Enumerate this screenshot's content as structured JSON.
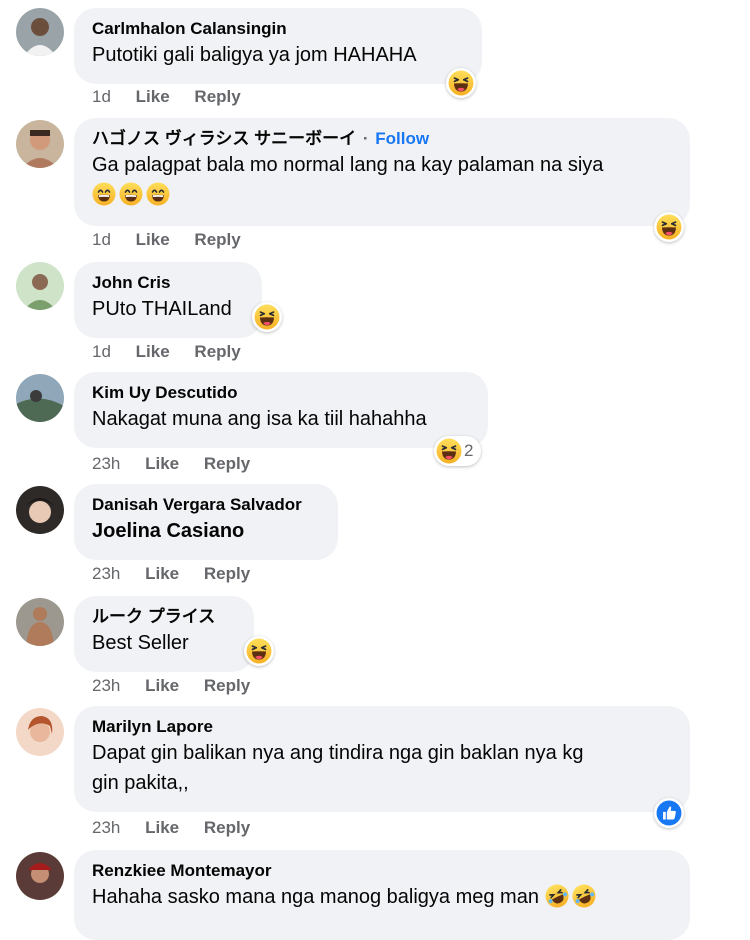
{
  "comments": [
    {
      "author": "Carlmhalon Calansingin",
      "text": "Putotiki gali baligya ya jom HAHAHA",
      "time": "1d",
      "like": "Like",
      "reply": "Reply",
      "reaction": "haha-icon"
    },
    {
      "author": "ハゴノス ヴィラシス サニーボーイ",
      "follow_sep": "·",
      "follow": "Follow",
      "text": "Ga palagpat bala mo normal lang na kay palaman na siya",
      "time": "1d",
      "like": "Like",
      "reply": "Reply",
      "reaction": "haha-icon"
    },
    {
      "author": "John Cris",
      "text": "PUto THAILand",
      "time": "1d",
      "like": "Like",
      "reply": "Reply",
      "reaction": "haha-icon"
    },
    {
      "author": "Kim Uy Descutido",
      "text": "Nakagat muna ang isa ka tiil hahahha",
      "time": "23h",
      "like": "Like",
      "reply": "Reply",
      "reaction": "haha-icon",
      "reaction_count": "2"
    },
    {
      "author": "Danisah Vergara Salvador",
      "text": "Joelina Casiano",
      "time": "23h",
      "like": "Like",
      "reply": "Reply"
    },
    {
      "author": "ルーク プライス",
      "text": "Best Seller",
      "time": "23h",
      "like": "Like",
      "reply": "Reply",
      "reaction": "haha-icon"
    },
    {
      "author": "Marilyn Lapore",
      "text_line1": "Dapat gin balikan nya ang tindira nga gin baklan nya kg",
      "text_line2": "gin pakita,,",
      "time": "23h",
      "like": "Like",
      "reply": "Reply",
      "reaction": "like-icon"
    },
    {
      "author": "Renzkiee Montemayor",
      "text": "Hahaha sasko mana nga manog baligya meg man"
    }
  ],
  "colors": {
    "bubble": "#f0f2f5",
    "meta": "#65676b",
    "link": "#1877f2",
    "haha": "#f7b125",
    "like": "#1877f2"
  }
}
